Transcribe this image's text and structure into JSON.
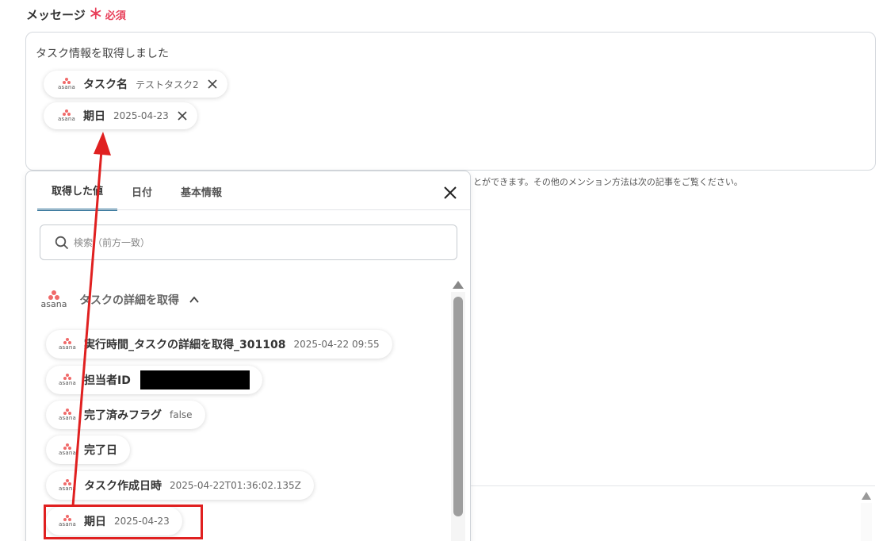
{
  "field": {
    "label": "メッセージ",
    "required_mark": "＊",
    "required_text": "必須"
  },
  "message": {
    "text": "タスク情報を取得しました",
    "chips": [
      {
        "label": "タスク名",
        "value": "テストタスク2"
      },
      {
        "label": "期日",
        "value": "2025-04-23"
      }
    ]
  },
  "helper_text": "とができます。その他のメンション方法は次の記事をご覧ください。",
  "popup": {
    "tabs": [
      "取得した値",
      "日付",
      "基本情報"
    ],
    "active_tab": "取得した値",
    "search_placeholder": "検索（前方一致）",
    "group": {
      "logo_text": "asana",
      "title": "タスクの詳細を取得",
      "items": [
        {
          "label": "実行時間_タスクの詳細を取得_301108",
          "value": "2025-04-22 09:55"
        },
        {
          "label": "担当者ID",
          "value": ""
        },
        {
          "label": "完了済みフラグ",
          "value": "false"
        },
        {
          "label": "完了日",
          "value": ""
        },
        {
          "label": "タスク作成日時",
          "value": "2025-04-22T01:36:02.135Z"
        },
        {
          "label": "期日",
          "value": "2025-04-23"
        }
      ]
    }
  },
  "colors": {
    "asana": "#f06a6a",
    "required": "#e8415b",
    "tab_underline": "#2a6f97",
    "annotation_red": "#e02020"
  },
  "icons": {
    "chip_remove": "close-icon",
    "popup_close": "close-icon",
    "search": "search-icon",
    "group_toggle": "chevron-up-icon",
    "app_logo": "asana-logo-icon"
  }
}
